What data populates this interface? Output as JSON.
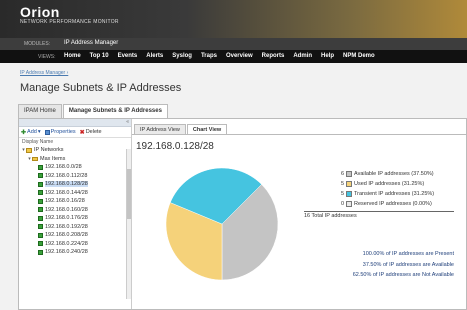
{
  "brand": {
    "name": "Orion",
    "subtitle": "NETWORK PERFORMANCE MONITOR"
  },
  "module_bar": {
    "label": "MODULES:",
    "value": "IP Address Manager"
  },
  "nav": {
    "label": "VIEWS:",
    "items": [
      "Home",
      "Top 10",
      "Events",
      "Alerts",
      "Syslog",
      "Traps",
      "Overview",
      "Reports",
      "Admin",
      "Help",
      "NPM Demo"
    ]
  },
  "breadcrumb": "IP Address Manager ›",
  "page_title": "Manage Subnets & IP Addresses",
  "tabs": [
    "IPAM Home",
    "Manage Subnets & IP Addresses"
  ],
  "left": {
    "toolbar": {
      "add": "Add",
      "properties": "Properties",
      "delete": "Delete"
    },
    "display_label": "Display Name",
    "tree": [
      {
        "label": "IP Networks",
        "type": "folder",
        "level": 0,
        "expanded": true
      },
      {
        "label": "Max Items",
        "type": "folder",
        "level": 1,
        "expanded": true
      },
      {
        "label": "192.168.0.0/28",
        "type": "subnet",
        "level": 2
      },
      {
        "label": "192.168.0.112/28",
        "type": "subnet",
        "level": 2
      },
      {
        "label": "192.168.0.128/28",
        "type": "subnet",
        "level": 2,
        "selected": true
      },
      {
        "label": "192.168.0.144/28",
        "type": "subnet",
        "level": 2
      },
      {
        "label": "192.168.0.16/28",
        "type": "subnet",
        "level": 2
      },
      {
        "label": "192.168.0.160/28",
        "type": "subnet",
        "level": 2
      },
      {
        "label": "192.168.0.176/28",
        "type": "subnet",
        "level": 2
      },
      {
        "label": "192.168.0.192/28",
        "type": "subnet",
        "level": 2
      },
      {
        "label": "192.168.0.208/28",
        "type": "subnet",
        "level": 2
      },
      {
        "label": "192.168.0.224/28",
        "type": "subnet",
        "level": 2
      },
      {
        "label": "192.168.0.240/28",
        "type": "subnet",
        "level": 2
      }
    ]
  },
  "right": {
    "tabs": [
      "IP Address View",
      "Chart View"
    ],
    "active_tab": 1,
    "subnet_title": "192.168.0.128/28",
    "legend": [
      {
        "count": "6",
        "label": "Available IP addresses (37.50%)",
        "color": "#c4c4c4"
      },
      {
        "count": "5",
        "label": "Used IP addresses (31.25%)",
        "color": "#f5d27a"
      },
      {
        "count": "5",
        "label": "Transient IP addresses (31.25%)",
        "color": "#45c4e0"
      },
      {
        "count": "0",
        "label": "Reserved IP addresses (0.00%)",
        "color": "#e8e8e8"
      }
    ],
    "total": "16 Total IP addresses",
    "percent_lines": [
      "100.00% of IP addresses are Present",
      "37.50% of IP addresses are Available",
      "62.50% of IP addresses are Not Available"
    ]
  },
  "chart_data": {
    "type": "pie",
    "categories": [
      "Available",
      "Used",
      "Transient",
      "Reserved"
    ],
    "values": [
      6,
      5,
      5,
      0
    ],
    "colors": [
      "#c4c4c4",
      "#f5d27a",
      "#45c4e0",
      "#e8e8e8"
    ]
  }
}
